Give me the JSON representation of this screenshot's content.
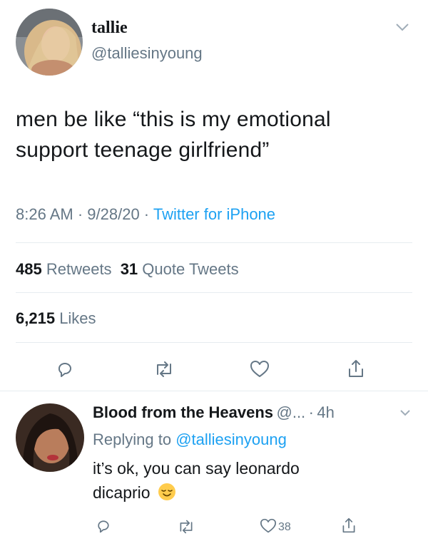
{
  "tweet": {
    "author_name": "tallie",
    "author_handle": "@talliesinyoung",
    "text_line1": "men be like “this is my emotional",
    "text_line2": "support teenage girlfriend”",
    "time": "8:26 AM",
    "date": "9/28/20",
    "source": "Twitter for iPhone",
    "retweets_count": "485",
    "retweets_label": "Retweets",
    "quotes_count": "31",
    "quotes_label": "Quote Tweets",
    "likes_count": "6,215",
    "likes_label": "Likes"
  },
  "reply": {
    "author_name": "Blood from the Heavens",
    "handle_truncated": "@...",
    "time": "4h",
    "replying_prefix": "Replying to",
    "replying_handle": "@talliesinyoung",
    "text_line1": "it’s ok, you can say leonardo",
    "text_line2": "dicaprio",
    "emoji": "relieved-face",
    "like_count": "38"
  },
  "colors": {
    "text": "#14171a",
    "secondary": "#657786",
    "link": "#1da1f2",
    "divider": "#e6ecf0",
    "icon": "#657786"
  },
  "icons": [
    "chevron-down-icon",
    "reply-icon",
    "retweet-icon",
    "like-icon",
    "share-icon"
  ]
}
